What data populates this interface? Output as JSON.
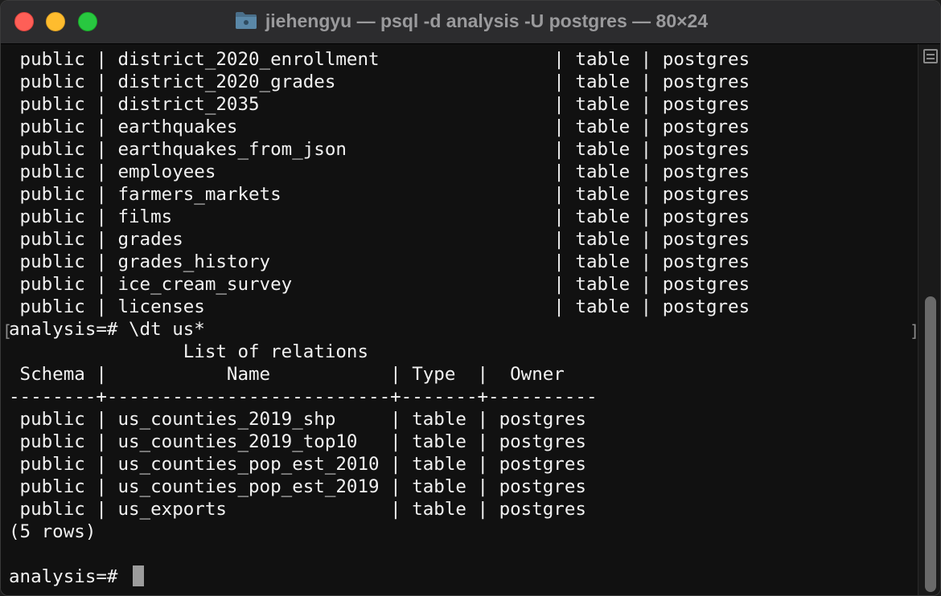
{
  "window": {
    "title": "jiehengyu — psql -d analysis -U postgres — 80×24",
    "title_icon": "folder-icon",
    "traffic_colors": {
      "close": "#fe5f57",
      "minimize": "#febc2e",
      "maximize": "#28c840"
    }
  },
  "terminal": {
    "background": "#111111",
    "foreground": "#f2f2f2",
    "lines": [
      " public | district_2020_enrollment                | table | postgres",
      " public | district_2020_grades                    | table | postgres",
      " public | district_2035                           | table | postgres",
      " public | earthquakes                             | table | postgres",
      " public | earthquakes_from_json                   | table | postgres",
      " public | employees                               | table | postgres",
      " public | farmers_markets                         | table | postgres",
      " public | films                                   | table | postgres",
      " public | grades                                  | table | postgres",
      " public | grades_history                          | table | postgres",
      " public | ice_cream_survey                        | table | postgres",
      " public | licenses                                | table | postgres",
      "analysis=# \\dt us*",
      "                List of relations",
      " Schema |           Name           | Type  |  Owner",
      "--------+--------------------------+-------+----------",
      " public | us_counties_2019_shp     | table | postgres",
      " public | us_counties_2019_top10   | table | postgres",
      " public | us_counties_pop_est_2010 | table | postgres",
      " public | us_counties_pop_est_2019 | table | postgres",
      " public | us_exports               | table | postgres",
      "(5 rows)",
      "",
      "analysis=# "
    ]
  }
}
